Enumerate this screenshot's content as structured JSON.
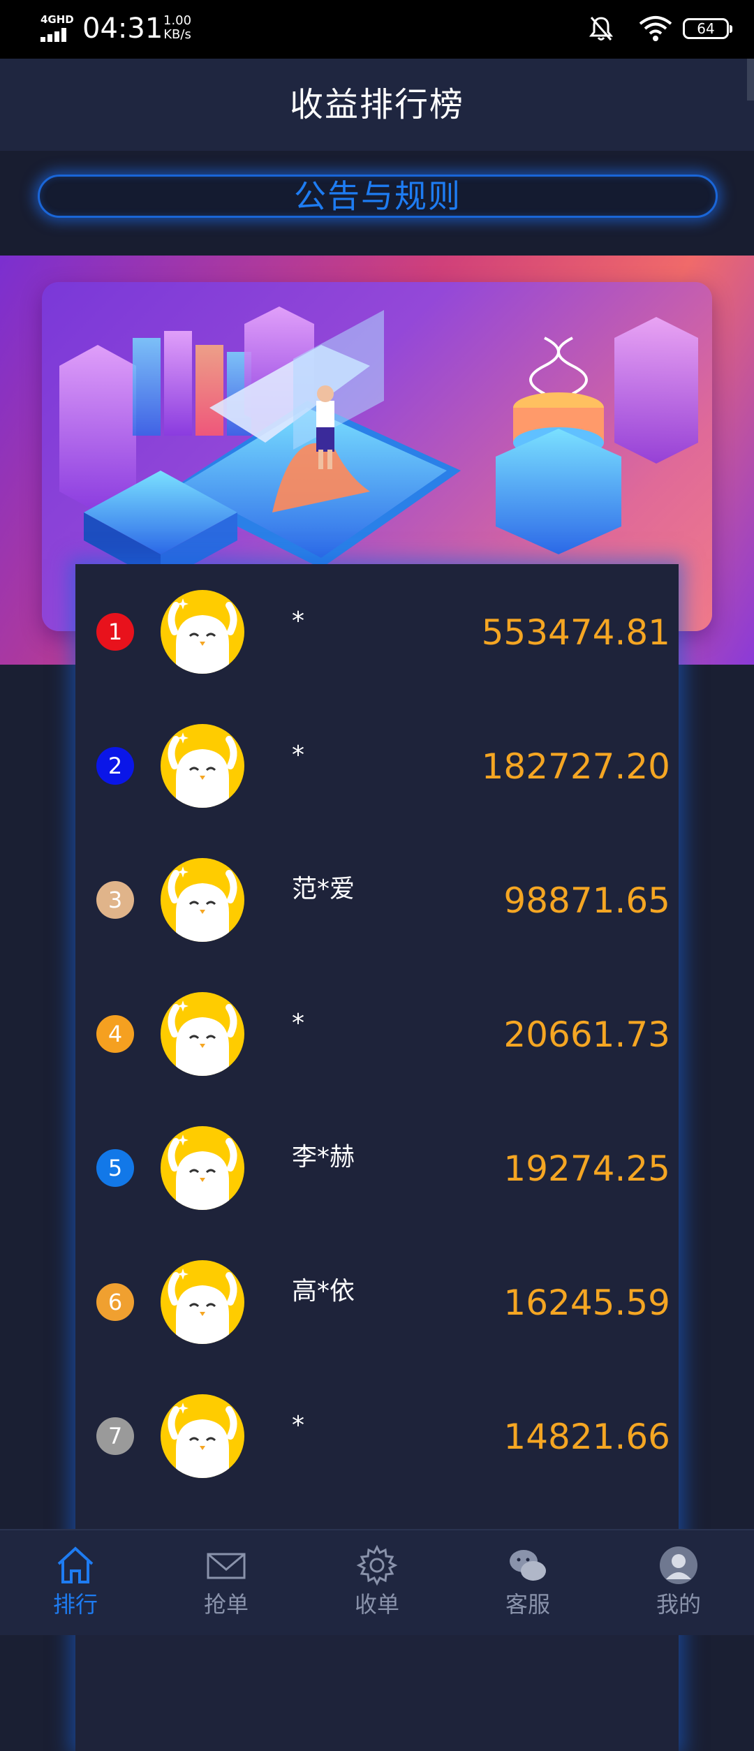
{
  "status_bar": {
    "network": "4GHD",
    "time": "04:31",
    "speed_value": "1.00",
    "speed_unit": "KB/s",
    "battery": "64"
  },
  "header": {
    "title": "收益排行榜"
  },
  "notice": {
    "label": "公告与规则"
  },
  "colors": {
    "accent": "#1e7cf2",
    "earnings": "#f5a623",
    "background": "#1a1f33"
  },
  "ranking": [
    {
      "rank": "1",
      "name": "*",
      "earnings": "553474.81",
      "badge_color": "#e8121c"
    },
    {
      "rank": "2",
      "name": "*",
      "earnings": "182727.20",
      "badge_color": "#0a16e8"
    },
    {
      "rank": "3",
      "name": "范*爱",
      "earnings": "98871.65",
      "badge_color": "#e0b48a"
    },
    {
      "rank": "4",
      "name": "*",
      "earnings": "20661.73",
      "badge_color": "#f5a020"
    },
    {
      "rank": "5",
      "name": "李*赫",
      "earnings": "19274.25",
      "badge_color": "#1278e8"
    },
    {
      "rank": "6",
      "name": "高*依",
      "earnings": "16245.59",
      "badge_color": "#f0a030"
    },
    {
      "rank": "7",
      "name": "*",
      "earnings": "14821.66",
      "badge_color": "#9a9a9a"
    }
  ],
  "bottom_nav": [
    {
      "label": "排行",
      "icon": "home-icon",
      "active": true
    },
    {
      "label": "抢单",
      "icon": "mail-icon",
      "active": false
    },
    {
      "label": "收单",
      "icon": "gear-icon",
      "active": false
    },
    {
      "label": "客服",
      "icon": "wechat-icon",
      "active": false
    },
    {
      "label": "我的",
      "icon": "user-icon",
      "active": false
    }
  ]
}
